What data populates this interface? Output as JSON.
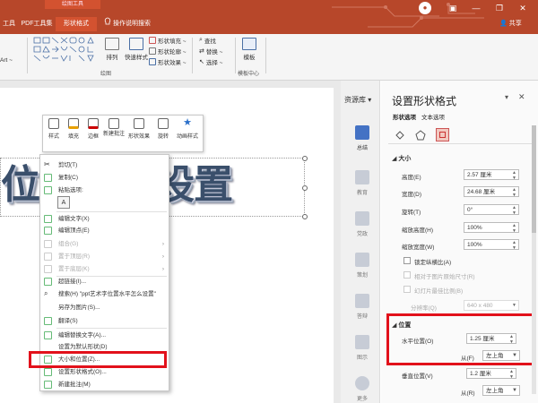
{
  "ribbon": {
    "contextual_group": "绘图工具",
    "tabs": [
      {
        "label": "工具"
      },
      {
        "label": "PDF工具集"
      },
      {
        "label": "形状格式"
      },
      {
        "label": "操作说明搜索"
      }
    ],
    "share_label": "共享",
    "wordart_label": "Art ~",
    "groups": {
      "drawing": "绘图",
      "template": "模板中心"
    },
    "items": {
      "arrange": "排列",
      "quick_styles": "快速样式",
      "shape_fill": "形状填充 ~",
      "shape_outline": "形状轮廓 ~",
      "shape_effects": "形状效果 ~",
      "find": "查找",
      "replace": "替换 ~",
      "select": "选择 ~",
      "template": "模板"
    }
  },
  "slide": {
    "wordart_text": "位置怎么设置"
  },
  "mini_toolbar": {
    "buttons": [
      "样式",
      "填充",
      "边框",
      "新建批注",
      "形状效果",
      "旋转",
      "动画样式"
    ]
  },
  "context_menu": {
    "items": [
      {
        "label": "剪切(T)",
        "disabled": false,
        "submenu": false
      },
      {
        "label": "复制(C)",
        "disabled": false,
        "submenu": false
      },
      {
        "label": "粘贴选项:",
        "disabled": false,
        "submenu": false
      },
      {
        "label": "编辑文字(X)",
        "disabled": false,
        "submenu": false
      },
      {
        "label": "编辑顶点(E)",
        "disabled": false,
        "submenu": false
      },
      {
        "label": "组合(G)",
        "disabled": true,
        "submenu": true
      },
      {
        "label": "置于顶层(R)",
        "disabled": true,
        "submenu": true
      },
      {
        "label": "置于底层(K)",
        "disabled": true,
        "submenu": true
      },
      {
        "label": "超链接(I)...",
        "disabled": false,
        "submenu": false
      },
      {
        "label": "搜索(H) \"ppt艺术字位置水平怎么设置\"",
        "disabled": false,
        "submenu": false
      },
      {
        "label": "另存为图片(S)...",
        "disabled": false,
        "submenu": false
      },
      {
        "label": "翻译(S)",
        "disabled": false,
        "submenu": false
      },
      {
        "label": "编辑替换文字(A)...",
        "disabled": false,
        "submenu": false
      },
      {
        "label": "设置为默认形状(D)",
        "disabled": false,
        "submenu": false
      },
      {
        "label": "大小和位置(Z)...",
        "disabled": false,
        "submenu": false
      },
      {
        "label": "设置形状格式(O)...",
        "disabled": false,
        "submenu": false
      },
      {
        "label": "新建批注(M)",
        "disabled": false,
        "submenu": false
      }
    ]
  },
  "library": {
    "header": "资源库 ▾",
    "items": [
      {
        "label": "总结",
        "active": true
      },
      {
        "label": "教育",
        "active": false
      },
      {
        "label": "党政",
        "active": false
      },
      {
        "label": "策划",
        "active": false
      },
      {
        "label": "答辩",
        "active": false
      },
      {
        "label": "图示",
        "active": false
      },
      {
        "label": "更多",
        "active": false
      }
    ]
  },
  "format_pane": {
    "title": "设置形状格式",
    "tabs": [
      "形状选项",
      "文本选项"
    ],
    "size_section": "大小",
    "height_label": "高度(E)",
    "height_value": "2.57 厘米",
    "width_label": "宽度(D)",
    "width_value": "24.68 厘米",
    "rotation_label": "旋转(T)",
    "rotation_value": "0°",
    "scale_h_label": "缩放高度(H)",
    "scale_h_value": "100%",
    "scale_w_label": "缩放宽度(W)",
    "scale_w_value": "100%",
    "lock_label": "锁定纵横比(A)",
    "relative_label": "相对于图片原始尺寸(R)",
    "best_label": "幻灯片最佳比例(B)",
    "resolution_label": "分辨率(Q)",
    "resolution_value": "640 x 480",
    "position_section": "位置",
    "hpos_label": "水平位置(O)",
    "hpos_value": "1.25 厘米",
    "from_label": "从(F)",
    "from_value": "左上角",
    "vpos_label": "垂直位置(V)",
    "vpos_value": "1.2 厘米",
    "from2_label": "从(R)",
    "from2_value": "左上角"
  },
  "colors": {
    "ribbon": "#b7472a",
    "highlight": "#e2111b"
  }
}
